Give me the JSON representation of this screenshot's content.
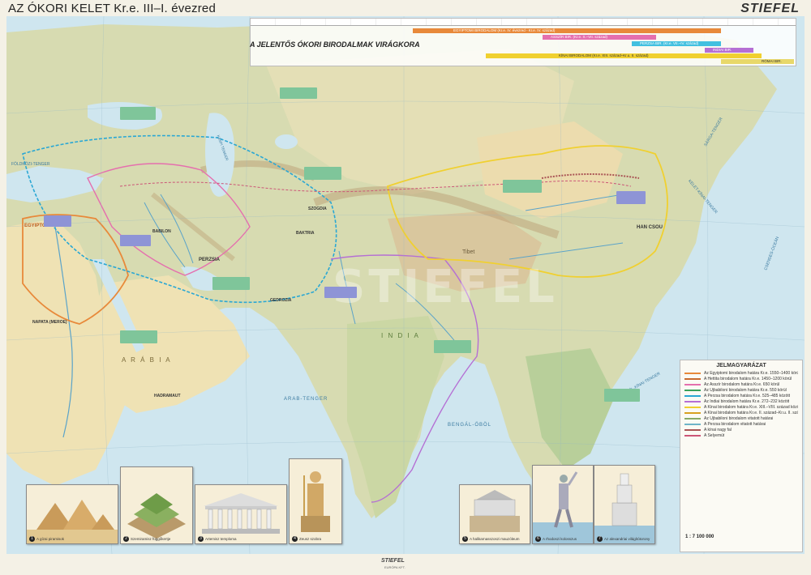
{
  "map": {
    "title": "AZ ÓKORI KELET  Kr.e. III–I. évezred",
    "publisher": "STIEFEL",
    "watermark": "STIEFEL"
  },
  "timeline": {
    "label": "A JELENTŐS ÓKORI BIRODALMAK VIRÁGKORA",
    "bars": [
      {
        "name": "EGYIPTOMI BIRODALOM (Kr.e. IV. évezred - Kr.e. IV. század)",
        "color": "#e8893a"
      },
      {
        "name": "ASSZÍR BIR. (Kr.e. X.–VII. század)",
        "color": "#e56fae"
      },
      {
        "name": "PERZSA BIR. (Kr.e. VII.–IV. század)",
        "color": "#42c0e0"
      },
      {
        "name": "INDIAI BIR.",
        "color": "#b56fd4"
      },
      {
        "name": "KÍNAI BIRODALOM (Kr.e. XIII. század–Kr.u. II. század)",
        "color": "#f0d030"
      },
      {
        "name": "RÓMAI BIR.",
        "color": "#e8d86a"
      }
    ]
  },
  "regions": {
    "arabia": "A R Á B I A",
    "tibet": "Tibet",
    "india": "I N D I A",
    "han": "HAN CSOU",
    "egyptom": "EGYIPTOM",
    "kaspi": "KASPI TENGER",
    "bengal": "BENGÁL-ÖBÖL",
    "arab_sea": "ARAB-TENGER",
    "kelet_kinai": "KELET-KÍNAI-TENGER",
    "sarga": "SÁRGA-TENGER",
    "csendes": "CSENDES-ÓCEÁN",
    "dk_kinai": "DÉL-KÍNAI-TENGER",
    "persia": "PERZSIA",
    "babilon": "BABILON",
    "gedrozia": "GEDROZIA",
    "baktria": "BAKTRIA",
    "szogdia": "SZOGDIA",
    "hadramaut": "HADRAMAUT",
    "napata": "NAPATA (MEROE)",
    "foldkozi": "FÖLDKÖZI-TENGER"
  },
  "legend": {
    "title": "JELMAGYARÁZAT",
    "items": [
      {
        "text": "Az Egyiptomi birodalom határa Kr.e. 1550–1400 körül",
        "color": "#e8893a"
      },
      {
        "text": "A Hettita birodalom határa Kr.e. 1450–1200 körül",
        "color": "#c76a2e"
      },
      {
        "text": "Az Asszír birodalom határa Kr.e. 650 körül",
        "color": "#e56fae"
      },
      {
        "text": "Az Újbabiloni birodalom határa Kr.e. 550 körül",
        "color": "#3aa05a"
      },
      {
        "text": "A Perzsa birodalom határa Kr.e. 525–485 között",
        "color": "#2aa7d4"
      },
      {
        "text": "Az Indiai birodalom határa Kr.e. 272–232 között",
        "color": "#b56fd4"
      },
      {
        "text": "A Kínai birodalom határa Kr.e. XIII.–VIII. század között",
        "color": "#f0d030"
      },
      {
        "text": "A Kínai birodalom határa Kr.e. II. század–Kr.u. II. század",
        "color": "#d8a020"
      },
      {
        "text": "Az Újbabiloni birodalom vitatott határai",
        "color": "#88aa66"
      },
      {
        "text": "A Perzsa birodalom vitatott határai",
        "color": "#6fb4c8"
      },
      {
        "text": "A kínai nagy fal",
        "color": "#aa5555"
      },
      {
        "text": "A Selyemút",
        "color": "#cc5577"
      }
    ],
    "scale": "1 : 7 100 000"
  },
  "wonders": [
    {
      "num": "1",
      "label": "A gízai piramisok"
    },
    {
      "num": "2",
      "label": "Szemiramisz függőkertje"
    },
    {
      "num": "3",
      "label": "Artemisz temploma"
    },
    {
      "num": "4",
      "label": "Zeusz szobra"
    },
    {
      "num": "5",
      "label": "A halikarnasszoszi mauzóleum"
    },
    {
      "num": "6",
      "label": "A rhodoszi kolosszus"
    },
    {
      "num": "7",
      "label": "Az alexandriai világítótorony"
    }
  ],
  "footer": {
    "publisher": "STIEFEL",
    "sub": "EURÓPA KFT."
  },
  "colors": {
    "sea": "#cfe6ef",
    "land": "#d7dbb1",
    "desert": "#efe2b4",
    "mountain": "#c9b58e"
  }
}
